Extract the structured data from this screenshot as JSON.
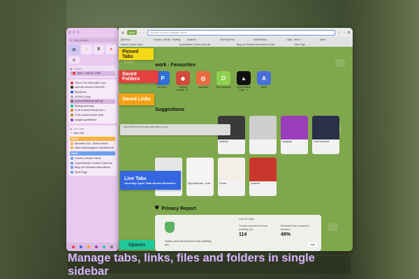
{
  "caption": "Manage tabs, links, files and folders in single sidebar",
  "callouts": {
    "pinned": "Pinned Tabs",
    "folders": "Saved Folders",
    "links": "Saved Links",
    "live": "Live Tabs",
    "live_sub": "Currently Open Tabs Across Browsers",
    "spaces": "Spaces"
  },
  "sidebar": {
    "search_placeholder": "Search tabs",
    "folders_header": "Folders",
    "folder_item": "Tabs - Feb 29, 2028",
    "links": [
      "This is The Best Milk Cust...",
      "android-chrome-192x192...",
      "Applicons",
      "512x512.png",
      "1440x900Remix with sp...",
      "Background.svg",
      "Fruit Custard Recipe (frui...",
      "Fruit custard recipe (fruit...",
      "awajishupertitlebar"
    ],
    "live_header": "Live Tabs",
    "live_new": "New Tab",
    "groups": [
      {
        "name": "Brave",
        "color": "#f5b53c",
        "items": [
          "Wrestlen Ex3 - Anime World",
          "https://dearkingdom.ustrathlan.tld"
        ]
      },
      {
        "name": "Safari",
        "color": "#6aa0ef",
        "items": [
          "Submit | Hacker News",
          "SuperSidebar Content Calendar",
          "Blog: Arc Browser Alternatives",
          "Start Page"
        ]
      }
    ]
  },
  "browser": {
    "tab_chip": "work",
    "url_placeholder": "Search or enter website name",
    "tabstrip": [
      "[M] Inbox",
      "Explore - Activity - Profiling",
      "Audience",
      "Zeb Payments",
      "SuperSidebar",
      "Login - Vercel",
      "admin"
    ],
    "tabstrip2": [
      "Submit | Hacker News",
      "SuperSidebar Content Calendar",
      "Blog: Arc Browser Alternatives for Mac",
      "Start Page"
    ],
    "favourites_title": "work - Favourites",
    "favourites": [
      {
        "label": "Let's live ...",
        "glyph": "P",
        "color": "#2f6fd9"
      },
      {
        "label": "Explore Activity - P...",
        "glyph": "◆",
        "color": "#d24a3a"
      },
      {
        "label": "Audience",
        "glyph": "◎",
        "color": "#e86a3e"
      },
      {
        "label": "Zeb Payments",
        "glyph": "D",
        "color": "#8fd14f"
      },
      {
        "label": "SuperSidebar - Login - V...",
        "glyph": "▲",
        "color": "#111111"
      },
      {
        "label": "admin",
        "glyph": "A",
        "color": "#4a6fd9"
      }
    ],
    "suggestions_title": "Suggestions",
    "tooltip": "1440x900Remix with logos and folders 1.png",
    "suggestions": [
      {
        "caption": "",
        "img": "#bcbcbc"
      },
      {
        "caption": "",
        "img": "#2a2a2a"
      },
      {
        "caption": "localhost",
        "img": "#3a3a3a"
      },
      {
        "caption": "",
        "img": "#cfcfcf"
      },
      {
        "caption": "Instagram",
        "img": "#9c3dbb"
      },
      {
        "caption": "Zeeb Payments",
        "img": "#2b2f48"
      },
      {
        "caption": "Gmail",
        "img": "#e6e6e6"
      },
      {
        "caption": "App Dashboard - Zeeb",
        "img": "#f4f4f4"
      },
      {
        "caption": "Claude",
        "img": "#f3efe8"
      },
      {
        "caption": "Audience",
        "img": "#c9372c"
      }
    ],
    "privacy_title": "Privacy Report",
    "privacy_text": "Safari prevents trackers from profiling you",
    "stat_period": "Last 30 days",
    "stat1_label": "Trackers prevented from profiling you",
    "stat1_value": "114",
    "stat2_label": "Websites that contacted trackers",
    "stat2_value": "49%",
    "edit_label": "Edit"
  }
}
